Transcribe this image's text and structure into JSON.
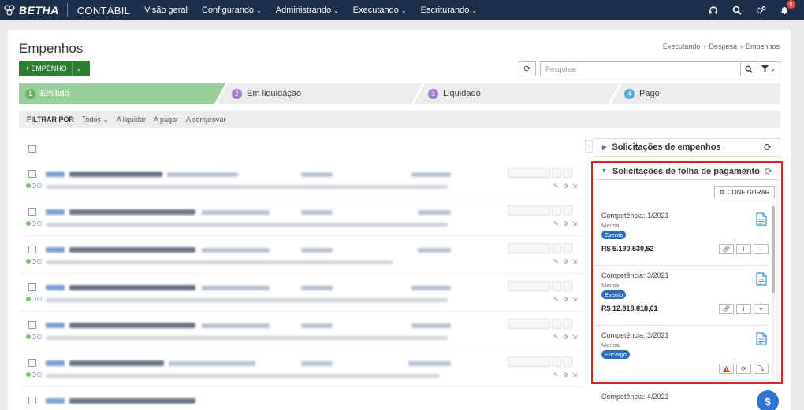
{
  "topbar": {
    "brand": "BETHA",
    "module": "CONTÁBIL",
    "nav": [
      {
        "label": "Visão geral",
        "has_menu": false
      },
      {
        "label": "Configurando",
        "has_menu": true
      },
      {
        "label": "Administrando",
        "has_menu": true
      },
      {
        "label": "Executando",
        "has_menu": true
      },
      {
        "label": "Escriturando",
        "has_menu": true
      }
    ],
    "icons": [
      "headset-icon",
      "search-icon",
      "gears-icon",
      "bell-icon"
    ],
    "notification_count": "6"
  },
  "page": {
    "title": "Empenhos",
    "breadcrumb": [
      "Executando",
      "Despesa",
      "Empenhos"
    ]
  },
  "toolbar": {
    "new_label": "EMPENHO",
    "search_placeholder": "Pesquisar"
  },
  "steps": [
    {
      "num": "1",
      "label": "Emitido",
      "active": true
    },
    {
      "num": "2",
      "label": "Em liquidação",
      "active": false
    },
    {
      "num": "3",
      "label": "Liquidado",
      "active": false
    },
    {
      "num": "4",
      "label": "Pago",
      "active": false
    }
  ],
  "filters": {
    "label": "FILTRAR POR",
    "options": [
      "Todos",
      "A liquidar",
      "A pagar",
      "A comprovar"
    ]
  },
  "rows": [
    {
      "name": "NC COMUNICAÇÕES S.A."
    },
    {
      "name": "MANNES MANGUEIRAS E VEDA..."
    },
    {
      "name": "USAPECAS COMERCIAL DE PEC..."
    },
    {
      "name": "CODEJAS CIA. DE DESENVOLVI..."
    },
    {
      "name": "CODEJAS CIA. DE DESENVOLVI..."
    },
    {
      "name": "POSTO AGRICOPEL LTDA."
    }
  ],
  "side_panel": {
    "section1_title": "Solicitações de empenhos",
    "section2_title": "Solicitações de folha de pagamento",
    "configure_label": "CONFIGURAR",
    "requests": [
      {
        "competencia": "Competência: 1/2021",
        "frequencia": "Mensal",
        "tipo": "Evento",
        "valor": "R$ 5.190.530,52"
      },
      {
        "competencia": "Competência: 3/2021",
        "frequencia": "Mensal",
        "tipo": "Evento",
        "valor": "R$ 12.818.818,61"
      },
      {
        "competencia": "Competência: 3/2021",
        "frequencia": "Mensal",
        "tipo": "Encargo",
        "valor": ""
      }
    ],
    "partial_request": {
      "competencia": "Competência: 4/2021"
    }
  },
  "colors": {
    "nav_bg": "#1b2f4b",
    "active_step": "#9bd09a",
    "primary_green": "#2e7d32",
    "badge_blue": "#2d6db5",
    "highlight_red": "#dd2222",
    "fab_blue": "#2f73d3"
  }
}
